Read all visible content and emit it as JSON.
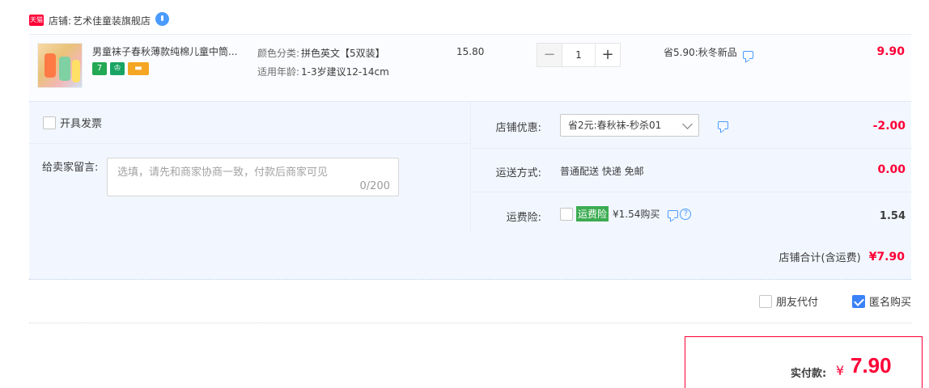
{
  "shop": {
    "tmall_badge": "天猫",
    "label": "店铺:",
    "name": "艺术佳童装旗舰店"
  },
  "item": {
    "title": "男童袜子春秋薄款纯棉儿童中筒...",
    "badges": [
      "7"
    ],
    "sku": [
      {
        "label": "颜色分类:",
        "value": "拼色英文【5双装】"
      },
      {
        "label": "适用年龄:",
        "value": "1-3岁建议12-14cm"
      }
    ],
    "unit_price": "15.80",
    "quantity": "1",
    "minus": "−",
    "plus": "+",
    "promo": "省5.90:秋冬新品",
    "total": "9.90"
  },
  "order": {
    "invoice_label": "开具发票",
    "note_label": "给卖家留言:",
    "note_placeholder": "选填，请先和商家协商一致，付款后商家可见",
    "note_count": "0/200",
    "coupon_label": "店铺优惠:",
    "coupon_selected": "省2元:春秋袜-秒杀01",
    "coupon_amount": "-2.00",
    "shipping_label": "运送方式:",
    "shipping_value": "普通配送 快递 免邮",
    "shipping_amount": "0.00",
    "insurance_label": "运费险:",
    "insurance_tag": "运费险",
    "insurance_price": "¥1.54购买",
    "insurance_amount": "1.54",
    "store_total_label": "店铺合计(含运费)",
    "store_total": "¥7.90"
  },
  "options": {
    "friend_pay": "朋友代付",
    "anonymous": "匿名购买"
  },
  "payment": {
    "label": "实付款:",
    "currency": "¥",
    "amount": "7.90"
  },
  "colors": {
    "accent": "#ff0036",
    "link": "#4a9bff",
    "panel": "#f2f7ff"
  }
}
